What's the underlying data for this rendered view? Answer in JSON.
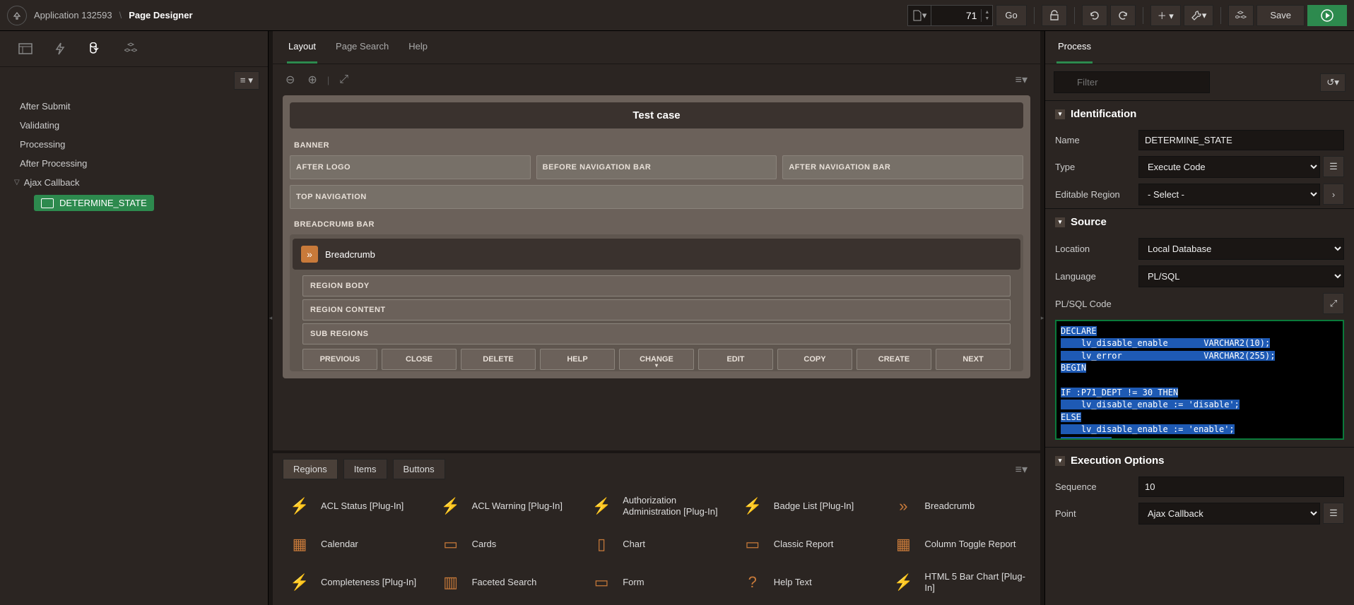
{
  "header": {
    "app_label": "Application 132593",
    "page_title": "Page Designer",
    "page_number": "71",
    "go_label": "Go",
    "save_label": "Save"
  },
  "left": {
    "tree_items": [
      "After Submit",
      "Validating",
      "Processing",
      "After Processing"
    ],
    "ajax_label": "Ajax Callback",
    "node_label": "DETERMINE_STATE"
  },
  "center": {
    "tabs": {
      "layout": "Layout",
      "page_search": "Page Search",
      "help": "Help"
    },
    "title": "Test case",
    "slots": {
      "banner": "BANNER",
      "after_logo": "AFTER LOGO",
      "before_nav": "BEFORE NAVIGATION BAR",
      "after_nav": "AFTER NAVIGATION BAR",
      "top_nav": "TOP NAVIGATION",
      "breadcrumb_bar": "BREADCRUMB BAR",
      "breadcrumb_region": "Breadcrumb",
      "region_body": "REGION BODY",
      "region_content": "REGION CONTENT",
      "sub_regions": "SUB REGIONS"
    },
    "buttons": [
      "PREVIOUS",
      "CLOSE",
      "DELETE",
      "HELP",
      "CHANGE",
      "EDIT",
      "COPY",
      "CREATE",
      "NEXT"
    ]
  },
  "gallery": {
    "tabs": {
      "regions": "Regions",
      "items": "Items",
      "buttons": "Buttons"
    },
    "items": [
      "ACL Status [Plug-In]",
      "ACL Warning [Plug-In]",
      "Authorization Administration [Plug-In]",
      "Badge List [Plug-In]",
      "Breadcrumb",
      "Calendar",
      "Cards",
      "Chart",
      "Classic Report",
      "Column Toggle Report",
      "Completeness [Plug-In]",
      "Faceted Search",
      "Form",
      "Help Text",
      "HTML 5 Bar Chart [Plug-In]"
    ]
  },
  "right": {
    "tab": "Process",
    "filter_placeholder": "Filter",
    "sections": {
      "identification": "Identification",
      "source": "Source",
      "exec": "Execution Options"
    },
    "fields": {
      "name_label": "Name",
      "name_value": "DETERMINE_STATE",
      "type_label": "Type",
      "type_value": "Execute Code",
      "editable_label": "Editable Region",
      "editable_value": "- Select -",
      "location_label": "Location",
      "location_value": "Local Database",
      "language_label": "Language",
      "language_value": "PL/SQL",
      "code_label": "PL/SQL Code",
      "sequence_label": "Sequence",
      "sequence_value": "10",
      "point_label": "Point",
      "point_value": "Ajax Callback"
    },
    "code_lines": [
      "DECLARE",
      "    lv_disable_enable       VARCHAR2(10);",
      "    lv_error                VARCHAR2(255);",
      "BEGIN",
      "",
      "IF :P71_DEPT != 30 THEN",
      "    lv_disable_enable := 'disable';",
      "ELSE",
      "    lv_disable_enable := 'enable';",
      "   END IF;"
    ]
  }
}
